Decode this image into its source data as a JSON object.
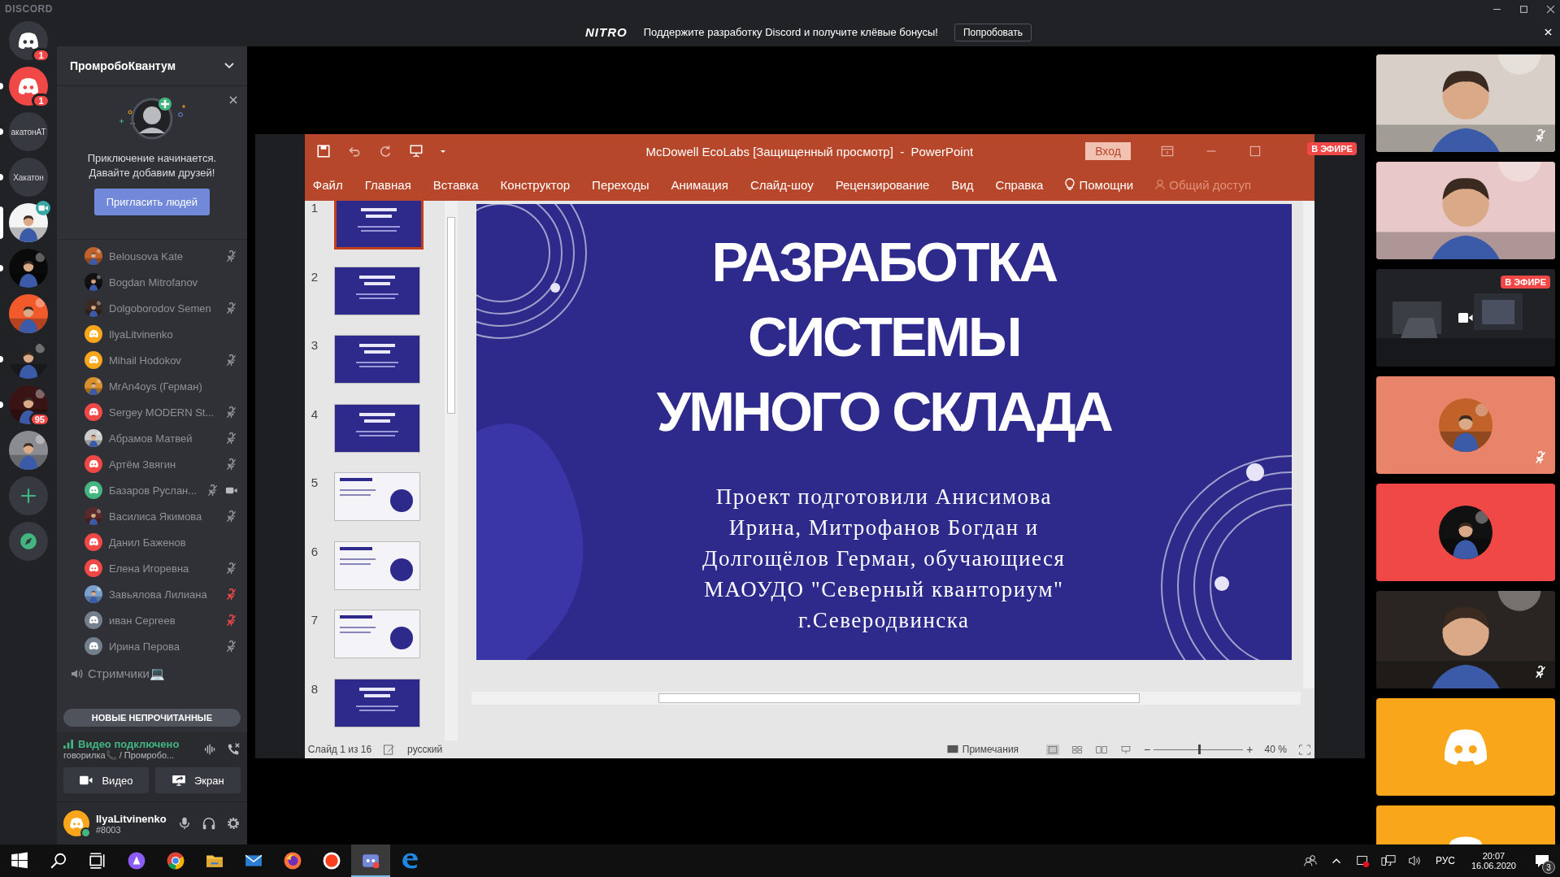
{
  "app": {
    "title": "DISCORD"
  },
  "nitro_banner": {
    "logo": "NITRO",
    "text": "Поддержите разработку Discord и получите клёвые бонусы!",
    "button": "Попробовать"
  },
  "servers": [
    {
      "kind": "logo",
      "color": "#36393f",
      "badge": "1",
      "unread": false,
      "selected": false,
      "video": false
    },
    {
      "kind": "logo",
      "color": "#f04747",
      "badge": "1",
      "unread": true,
      "selected": false,
      "video": false
    },
    {
      "kind": "text",
      "label": "акатонАТ",
      "unread": true,
      "selected": false,
      "video": false
    },
    {
      "kind": "text",
      "label": "Хакатон",
      "unread": true,
      "selected": false,
      "video": false
    },
    {
      "kind": "picture",
      "color": "#f4f4f4",
      "unread": false,
      "selected": true,
      "video": true
    },
    {
      "kind": "picture",
      "color": "#0a0a0a",
      "unread": true,
      "selected": false,
      "video": false
    },
    {
      "kind": "picture",
      "color": "#f25a2c",
      "unread": false,
      "selected": false,
      "video": false
    },
    {
      "kind": "picture",
      "color": "#202225",
      "unread": true,
      "selected": false,
      "video": false
    },
    {
      "kind": "picture",
      "color": "#3a1414",
      "badge": "95",
      "unread": true,
      "selected": false,
      "video": false
    },
    {
      "kind": "picture",
      "color": "#8a8c92",
      "unread": false,
      "selected": false,
      "video": false
    },
    {
      "kind": "add",
      "unread": false,
      "selected": false,
      "video": false
    },
    {
      "kind": "explore",
      "unread": false,
      "selected": false,
      "video": false
    }
  ],
  "sidebar": {
    "server_name": "ПромробоКвантум",
    "invite": {
      "text": "Приключение начинается.\nДавайте добавим друзей!",
      "button": "Пригласить людей"
    },
    "members": [
      {
        "name": "Belousova Kate",
        "kind": "picture",
        "color": "#c0622a",
        "muted": true,
        "server_muted": false,
        "video": false
      },
      {
        "name": "Bogdan Mitrofanov",
        "kind": "picture",
        "color": "#111111",
        "muted": false,
        "server_muted": false,
        "video": false
      },
      {
        "name": "Dolgoborodov Semen",
        "kind": "picture",
        "color": "#3a2a20",
        "muted": true,
        "server_muted": false,
        "video": false
      },
      {
        "name": "IlyaLitvinenko",
        "kind": "logo",
        "color": "#faa61a",
        "muted": false,
        "server_muted": false,
        "video": false
      },
      {
        "name": "Mihail Hodokov",
        "kind": "logo",
        "color": "#faa61a",
        "muted": true,
        "server_muted": false,
        "video": false
      },
      {
        "name": "MrAn4oys (Герман)",
        "kind": "picture",
        "color": "#d8902a",
        "muted": false,
        "server_muted": false,
        "video": false
      },
      {
        "name": "Sergey MODERN St...",
        "kind": "logo",
        "color": "#f04747",
        "muted": true,
        "server_muted": false,
        "video": false
      },
      {
        "name": "Абрамов Матвей",
        "kind": "picture",
        "color": "#cccccc",
        "muted": true,
        "server_muted": false,
        "video": false
      },
      {
        "name": "Артём Звягин",
        "kind": "logo",
        "color": "#f04747",
        "muted": true,
        "server_muted": false,
        "video": false
      },
      {
        "name": "Базаров Руслан...",
        "kind": "logo",
        "color": "#43b581",
        "muted": true,
        "server_muted": false,
        "video": true
      },
      {
        "name": "Василиса Якимова",
        "kind": "picture",
        "color": "#5a2a2a",
        "muted": true,
        "server_muted": false,
        "video": false
      },
      {
        "name": "Данил Баженов",
        "kind": "logo",
        "color": "#f04747",
        "muted": false,
        "server_muted": false,
        "video": false
      },
      {
        "name": "Елена Игоревна",
        "kind": "logo",
        "color": "#f04747",
        "muted": true,
        "server_muted": false,
        "video": false
      },
      {
        "name": "Завьялова Лилиана",
        "kind": "picture",
        "color": "#7aa0d0",
        "muted": false,
        "server_muted": true,
        "video": false
      },
      {
        "name": "иван Сергеев",
        "kind": "logo",
        "color": "#747f8d",
        "muted": false,
        "server_muted": true,
        "video": false
      },
      {
        "name": "Ирина Перова",
        "kind": "logo",
        "color": "#747f8d",
        "muted": true,
        "server_muted": false,
        "video": false
      }
    ],
    "channel": "Стримчики💻",
    "unread_banner": "НОВЫЕ НЕПРОЧИТАННЫЕ",
    "voice": {
      "status": "Видео подключено",
      "location": "говорилка📞 / Промробо...",
      "buttons": [
        "Видео",
        "Экран"
      ]
    },
    "user": {
      "name": "IlyaLitvinenko",
      "tag": "#8003"
    }
  },
  "stage": {
    "live_badge": "В ЭФИРЕ",
    "powerpoint": {
      "title": "McDowell EcoLabs [Защищенный просмотр]  -  PowerPoint",
      "signin": "Вход",
      "menu": [
        "Файл",
        "Главная",
        "Вставка",
        "Конструктор",
        "Переходы",
        "Анимация",
        "Слайд-шоу",
        "Рецензирование",
        "Вид",
        "Справка"
      ],
      "help": "Помощни",
      "share": "Общий доступ",
      "thumbnails": [
        {
          "number": "1",
          "kind": "dark",
          "selected": true
        },
        {
          "number": "2",
          "kind": "dark",
          "selected": false
        },
        {
          "number": "3",
          "kind": "dark",
          "selected": false
        },
        {
          "number": "4",
          "kind": "dark",
          "selected": false
        },
        {
          "number": "5",
          "kind": "light",
          "selected": false
        },
        {
          "number": "6",
          "kind": "light",
          "selected": false
        },
        {
          "number": "7",
          "kind": "light",
          "selected": false
        },
        {
          "number": "8",
          "kind": "dark",
          "selected": false
        }
      ],
      "slide": {
        "title": "РАЗРАБОТКА\nСИСТЕМЫ\nУМНОГО СКЛАДА",
        "body": "Проект подготовили Анисимова\nИрина, Митрофанов Богдан и\nДолгощёлов Герман, обучающиеся\nМАОУДО \"Северный кванториум\"\nг.Северодвинска"
      },
      "status": {
        "slide": "Слайд 1 из 16",
        "language": "русский",
        "notes": "Примечания",
        "zoom_out": "−",
        "zoom_in": "+",
        "zoom": "40 %",
        "level": 0.5
      }
    }
  },
  "video_tiles": [
    {
      "kind": "camera",
      "color": "#d8d0c8",
      "muted": true
    },
    {
      "kind": "camera",
      "color": "#e8c8c8",
      "muted": false
    },
    {
      "kind": "stream",
      "color": "#202225",
      "muted": false,
      "live_badge": "В ЭФИРЕ"
    },
    {
      "kind": "avatar",
      "color": "#e8846a",
      "avatar": {
        "color": "#c0622a"
      },
      "muted": true
    },
    {
      "kind": "avatar",
      "color": "#f04747",
      "avatar": {
        "color": "#111111"
      },
      "muted": false
    },
    {
      "kind": "camera",
      "color": "#2a2522",
      "muted": true
    },
    {
      "kind": "logo",
      "color": "#faa61a",
      "muted": false
    },
    {
      "kind": "logo",
      "color": "#faa61a"
    }
  ],
  "taskbar": {
    "apps": [
      {
        "kind": "start",
        "active": false
      },
      {
        "kind": "search",
        "active": false
      },
      {
        "kind": "taskview",
        "active": false
      },
      {
        "kind": "assistant",
        "active": false
      },
      {
        "kind": "chrome",
        "active": false
      },
      {
        "kind": "explorer",
        "active": false
      },
      {
        "kind": "mail",
        "active": false
      },
      {
        "kind": "firefox",
        "active": false
      },
      {
        "kind": "yandex",
        "active": false
      },
      {
        "kind": "discord",
        "active": true
      },
      {
        "kind": "edge",
        "active": false
      }
    ],
    "language": "РУС",
    "time": "20:07",
    "date": "16.06.2020",
    "notifications": "3"
  }
}
